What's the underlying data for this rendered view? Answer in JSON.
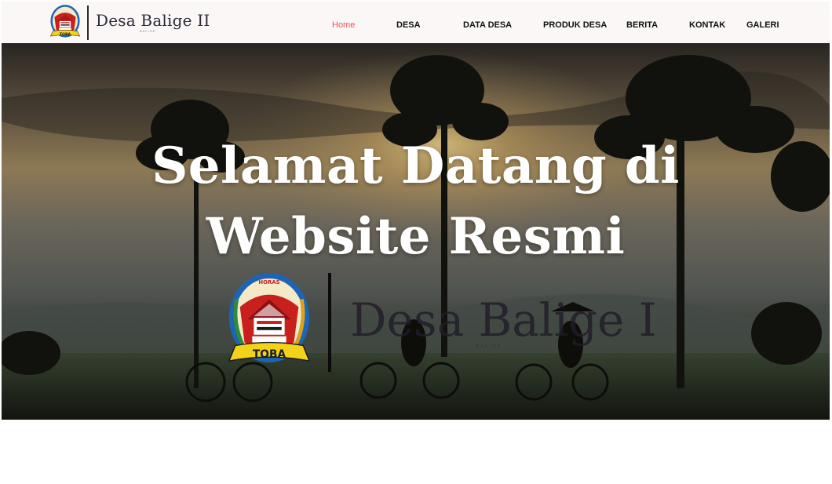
{
  "brand": {
    "name": "Desa Balige II",
    "sub": "BALIGE",
    "emblem_ribbon": "TOBA",
    "emblem_motto": "HORAS"
  },
  "nav": {
    "items": [
      {
        "label": "Home",
        "active": true
      },
      {
        "label": "DESA",
        "active": false
      },
      {
        "label": "DATA DESA",
        "active": false
      },
      {
        "label": "PRODUK DESA",
        "active": false
      },
      {
        "label": "BERITA",
        "active": false
      },
      {
        "label": "KONTAK",
        "active": false
      },
      {
        "label": "GALERI",
        "active": false
      }
    ]
  },
  "hero": {
    "title_line1": "Selamat Datang di",
    "title_line2": "Website Resmi",
    "brand_name": "Desa Balige I",
    "brand_sub": "BALIGE"
  },
  "colors": {
    "nav_active": "#e8555a",
    "nav_text": "#111111",
    "navbar_bg": "#fbf7f7",
    "hero_title": "#ffffff",
    "emblem_ribbon": "#f2d21b",
    "emblem_ring": "#1e64b4",
    "emblem_field": "#c8211d"
  }
}
